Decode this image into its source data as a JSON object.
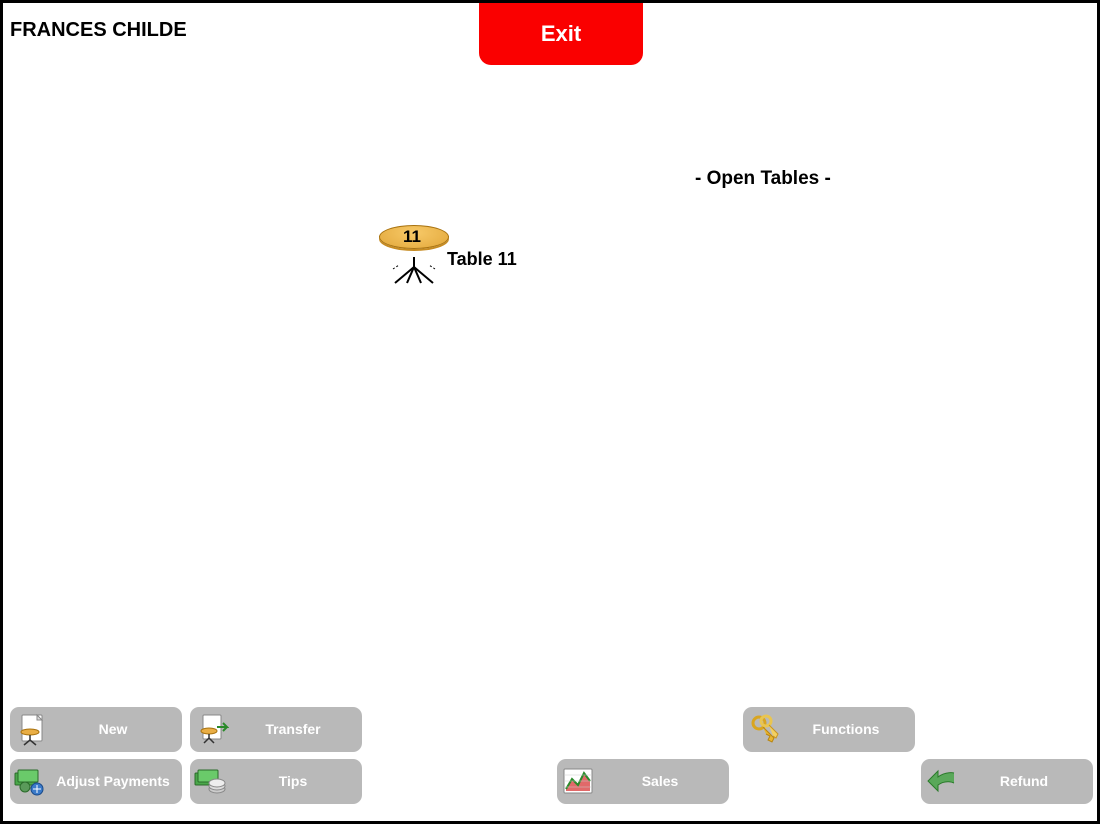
{
  "user_name": "FRANCES CHILDE",
  "exit_label": "Exit",
  "open_tables_label": "- Open Tables -",
  "table": {
    "number": "11",
    "label": "Table 11"
  },
  "actions": {
    "new": "New",
    "transfer": "Transfer",
    "adjust_payments": "Adjust Payments",
    "tips": "Tips",
    "sales": "Sales",
    "functions": "Functions",
    "refund": "Refund"
  },
  "colors": {
    "exit_bg": "#fa0000",
    "button_bg": "#b9b9b9",
    "table_top": "#e9ae45"
  }
}
